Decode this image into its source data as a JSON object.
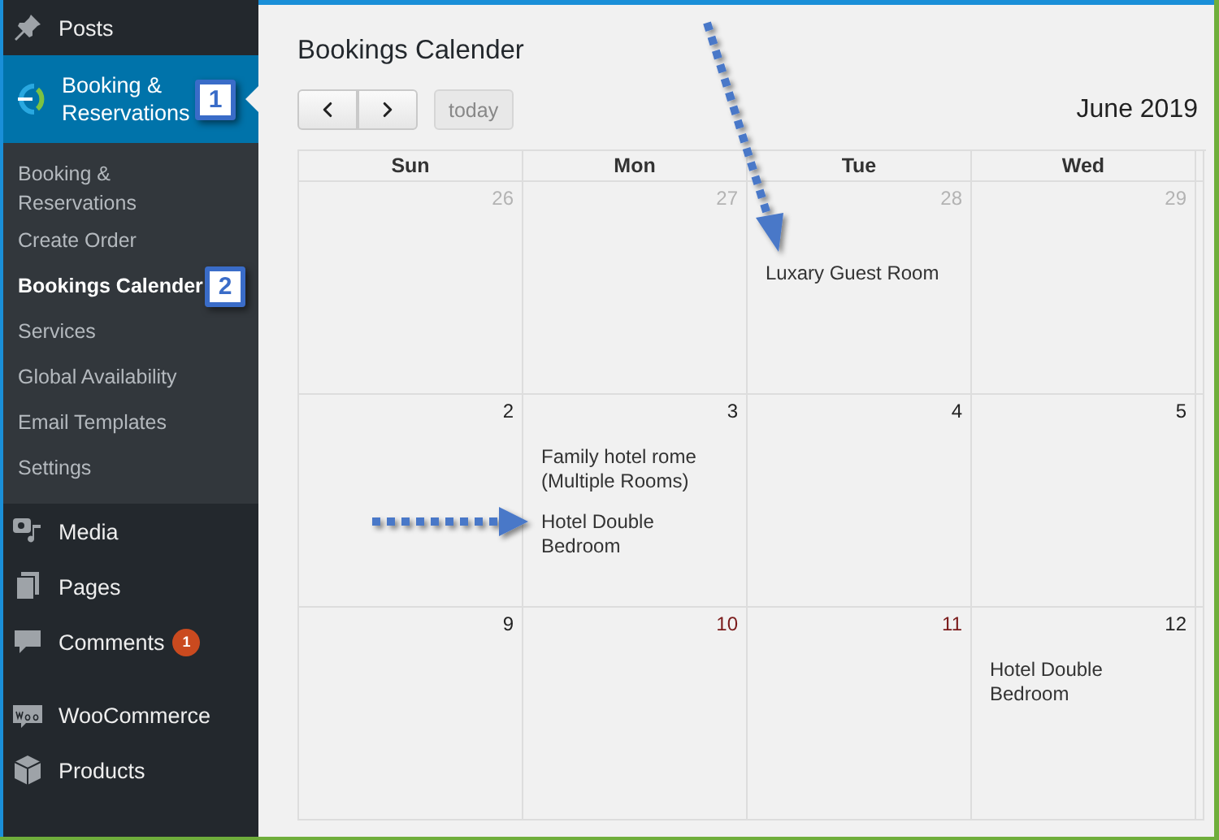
{
  "sidebar": {
    "items": [
      {
        "label": "Posts",
        "selected": false
      },
      {
        "label": "Booking & Reservations",
        "selected": true,
        "annotation": "1",
        "submenu": [
          {
            "label": "Booking & Reservations",
            "selected": false
          },
          {
            "label": "Create Order",
            "selected": false
          },
          {
            "label": "Bookings Calender",
            "selected": true,
            "annotation": "2"
          },
          {
            "label": "Services",
            "selected": false
          },
          {
            "label": "Global Availability",
            "selected": false
          },
          {
            "label": "Email Templates",
            "selected": false
          },
          {
            "label": "Settings",
            "selected": false
          }
        ]
      },
      {
        "label": "Media",
        "selected": false
      },
      {
        "label": "Pages",
        "selected": false
      },
      {
        "label": "Comments",
        "selected": false,
        "badge": "1"
      },
      {
        "label": "WooCommerce",
        "selected": false
      },
      {
        "label": "Products",
        "selected": false
      }
    ]
  },
  "page": {
    "title": "Bookings Calender"
  },
  "calendar": {
    "today_button": {
      "label": "today",
      "disabled": true
    },
    "month": "June 2019",
    "columns": [
      "Sun",
      "Mon",
      "Tue",
      "Wed"
    ],
    "weeks": [
      {
        "days": [
          {
            "number": "26",
            "color": "#b3b3b3"
          },
          {
            "number": "27",
            "color": "#b3b3b3"
          },
          {
            "number": "28",
            "color": "#b3b3b3",
            "events": [
              "Luxary Guest Room"
            ]
          },
          {
            "number": "29",
            "color": "#b3b3b3"
          }
        ]
      },
      {
        "days": [
          {
            "number": "2",
            "color": "#222222"
          },
          {
            "number": "3",
            "color": "#222222",
            "events": [
              "Family hotel rome (Multiple Rooms)",
              "Hotel Double Bedroom"
            ]
          },
          {
            "number": "4",
            "color": "#222222"
          },
          {
            "number": "5",
            "color": "#222222"
          }
        ]
      },
      {
        "days": [
          {
            "number": "9",
            "color": "#222222"
          },
          {
            "number": "10",
            "color": "#7a1a1a"
          },
          {
            "number": "11",
            "color": "#7a1a1a"
          },
          {
            "number": "12",
            "color": "#222222",
            "events": [
              "Hotel Double Bedroom"
            ]
          }
        ]
      }
    ]
  }
}
